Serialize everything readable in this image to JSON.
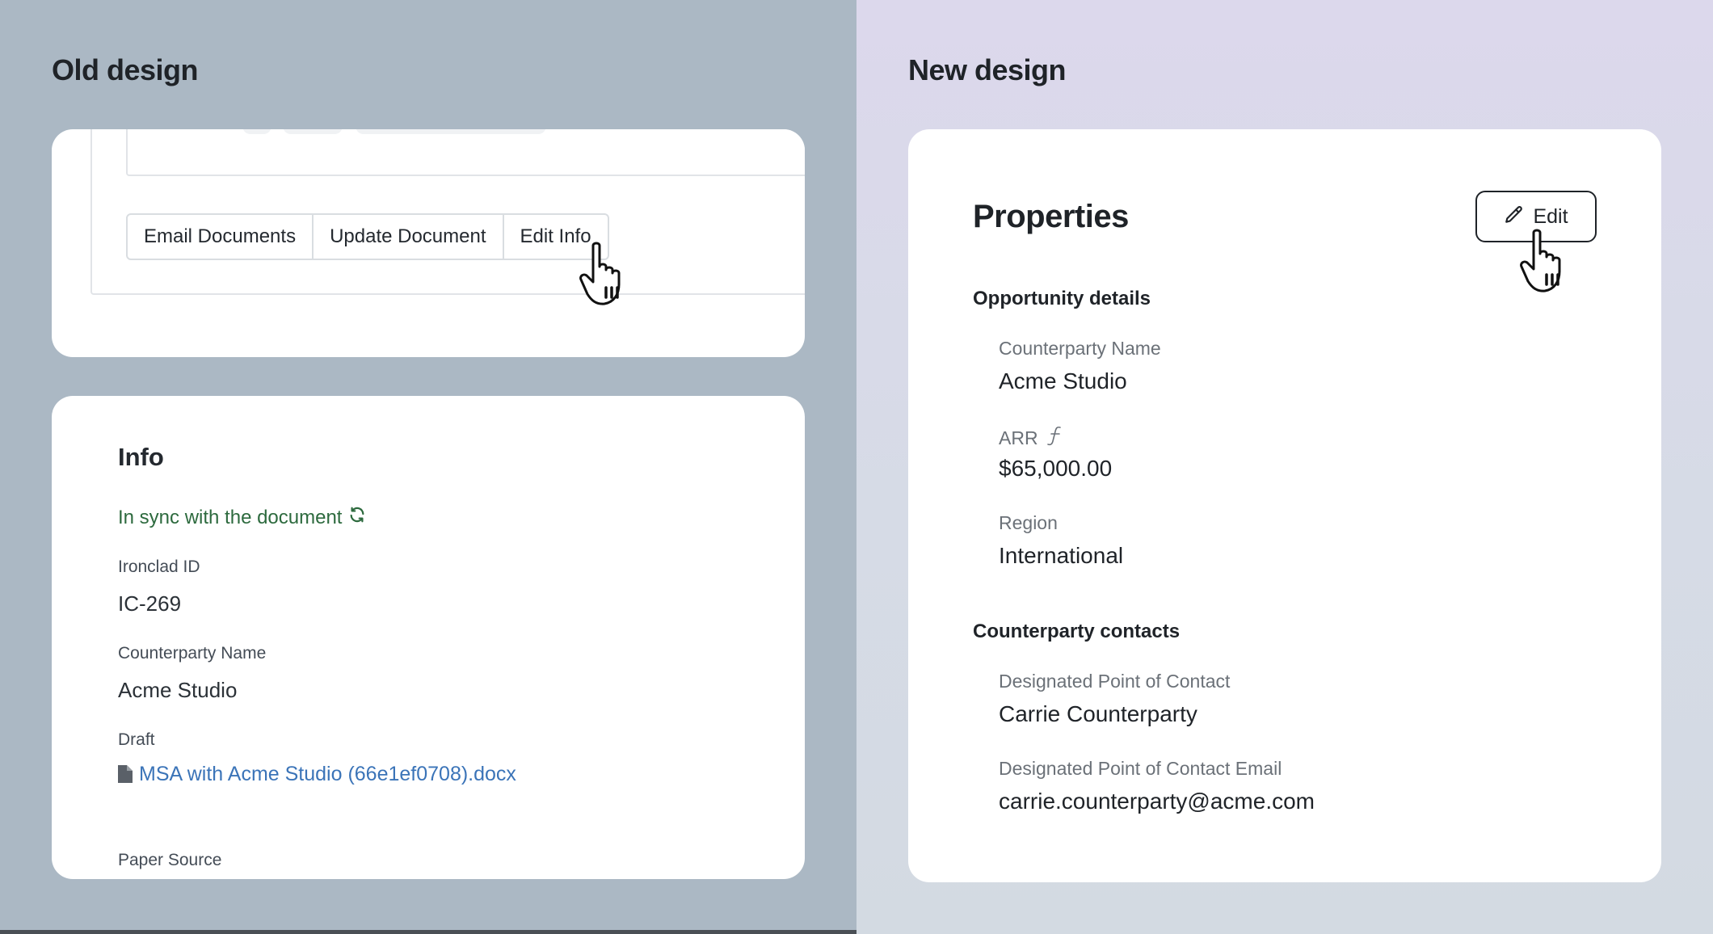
{
  "left_panel": {
    "heading": "Old design",
    "toolbar": {
      "buttons": [
        "Email Documents",
        "Update Document",
        "Edit Info"
      ]
    },
    "info": {
      "title": "Info",
      "sync_status": "In sync with the document",
      "fields": [
        {
          "label": "Ironclad ID",
          "value": "IC-269"
        },
        {
          "label": "Counterparty Name",
          "value": "Acme Studio"
        }
      ],
      "draft": {
        "label": "Draft",
        "file": "MSA with Acme Studio (66e1ef0708).docx"
      },
      "paper_source_label": "Paper Source"
    }
  },
  "right_panel": {
    "heading": "New design",
    "properties": {
      "title": "Properties",
      "edit_label": "Edit",
      "groups": [
        {
          "title": "Opportunity details",
          "fields": [
            {
              "label": "Counterparty Name",
              "value": "Acme Studio"
            },
            {
              "label": "ARR",
              "value": "$65,000.00",
              "has_formula_icon": true
            },
            {
              "label": "Region",
              "value": "International"
            }
          ]
        },
        {
          "title": "Counterparty contacts",
          "fields": [
            {
              "label": "Designated Point of Contact",
              "value": "Carrie Counterparty"
            },
            {
              "label": "Designated Point of Contact Email",
              "value": "carrie.counterparty@acme.com"
            }
          ]
        }
      ]
    }
  },
  "colors": {
    "left_bg": "#abb8c4",
    "right_bg": "#dcd8ec",
    "sync_green": "#2d6a3e",
    "link_blue": "#3b74b8"
  },
  "icons": [
    "sync-icon",
    "document-icon",
    "pencil-icon",
    "formula-icon",
    "hand-cursor-icon"
  ]
}
